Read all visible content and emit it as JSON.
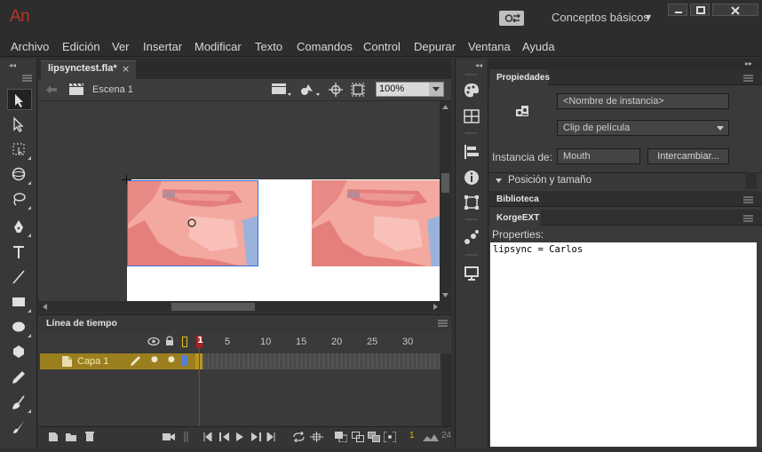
{
  "app": {
    "logo": "An",
    "workspace": "Conceptos básicos"
  },
  "menu": [
    "Archivo",
    "Edición",
    "Ver",
    "Insertar",
    "Modificar",
    "Texto",
    "Comandos",
    "Control",
    "Depurar",
    "Ventana",
    "Ayuda"
  ],
  "document": {
    "tab_label": "lipsynctest.fla*",
    "tab_close": "×",
    "scene": "Escena 1",
    "zoom": "100%"
  },
  "timeline": {
    "title": "Línea de tiempo",
    "ruler": [
      "1",
      "5",
      "10",
      "15",
      "20",
      "25",
      "30"
    ],
    "layer_name": "Capa 1",
    "fps_display": "1",
    "frame_display": "24"
  },
  "properties": {
    "title": "Propiedades",
    "instance_name_placeholder": "<Nombre de instancia>",
    "symbol_type": "Clip de película",
    "instance_of_label": "Instancia de:",
    "instance_of_value": "Mouth",
    "swap_button": "Intercambiar...",
    "position_section": "Posición y tamaño"
  },
  "library": {
    "title": "Biblioteca"
  },
  "korgeext": {
    "title": "KorgeEXT",
    "properties_label": "Properties:",
    "code": "lipsync = Carlos"
  },
  "colors": {
    "accent_logo": "#b8352a",
    "layer_highlight": "#9b7f1f",
    "playhead": "#b02020",
    "selection": "#3a6fd6"
  },
  "icons": [
    "sync-icon",
    "minimize-icon",
    "maximize-icon",
    "close-icon",
    "selection-tool-icon",
    "subselection-tool-icon",
    "free-transform-icon",
    "3d-rotation-icon",
    "lasso-icon",
    "pen-icon",
    "text-icon",
    "line-icon",
    "rectangle-icon",
    "oval-icon",
    "polystar-icon",
    "pencil-icon",
    "brush-icon",
    "paint-brush-icon"
  ]
}
